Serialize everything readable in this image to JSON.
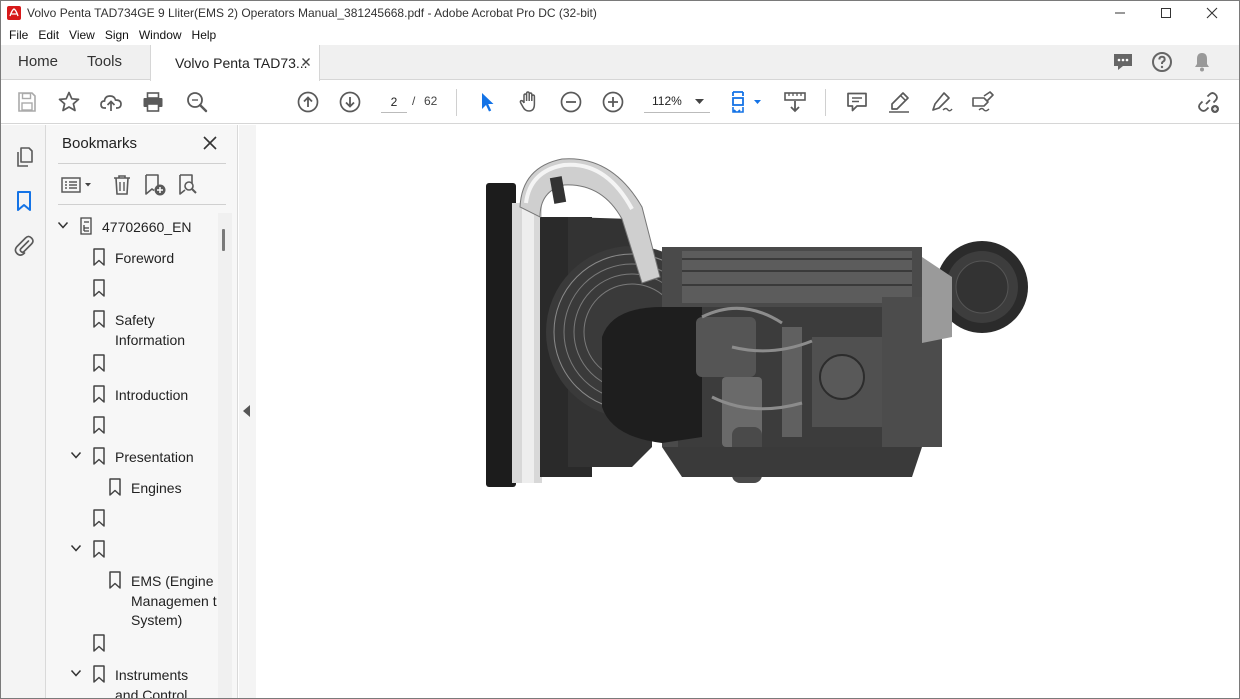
{
  "window": {
    "title": "Volvo Penta TAD734GE 9 Lliter(EMS 2) Operators Manual_381245668.pdf - Adobe Acrobat Pro DC (32-bit)"
  },
  "menu": [
    "File",
    "Edit",
    "View",
    "Sign",
    "Window",
    "Help"
  ],
  "tabs": {
    "home": "Home",
    "tools": "Tools",
    "document": "Volvo Penta TAD73..."
  },
  "toolbar": {
    "current_page": "2",
    "page_separator": "/",
    "total_pages": "62",
    "zoom": "112%"
  },
  "panel": {
    "title": "Bookmarks"
  },
  "bookmarks": [
    {
      "label": "47702660_EN",
      "expanded": true
    },
    {
      "label": "Foreword"
    },
    {
      "label": ""
    },
    {
      "label": "Safety Information"
    },
    {
      "label": ""
    },
    {
      "label": "Introduction"
    },
    {
      "label": ""
    },
    {
      "label": "Presentation",
      "expanded": true
    },
    {
      "label": "Engines"
    },
    {
      "label": ""
    },
    {
      "label": "",
      "expanded": true
    },
    {
      "label": "EMS (Engine Managemen t System)"
    },
    {
      "label": ""
    },
    {
      "label": "Instruments and Control",
      "expanded": true
    }
  ],
  "colors": {
    "accent_blue": "#1473e6",
    "icon_gray": "#5a5a5a",
    "acrobat_red": "#d7191a"
  },
  "icons": {
    "rail": [
      "pages-icon",
      "bookmark-icon",
      "attachment-icon"
    ],
    "toolbar": [
      "save-icon",
      "star-icon",
      "cloud-upload-icon",
      "print-icon",
      "search-zoom-icon",
      "page-up-icon",
      "page-down-icon",
      "select-arrow-icon",
      "hand-icon",
      "zoom-out-icon",
      "zoom-in-icon",
      "page-view-icon",
      "scroll-mode-icon",
      "comment-icon",
      "highlight-pen-icon",
      "draw-icon",
      "sign-icon",
      "share-link-icon"
    ]
  }
}
